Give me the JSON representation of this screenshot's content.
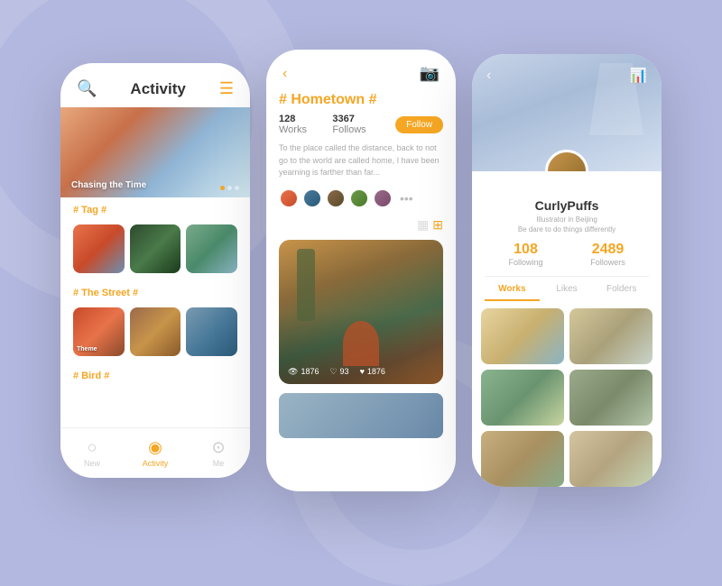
{
  "background_color": "#b3b8e0",
  "phone1": {
    "title": "Activity",
    "hero_label": "Chasing the Time",
    "section_tag": "# Tag #",
    "section_street": "# The Street #",
    "section_bird": "# Bird #",
    "nav": [
      {
        "label": "New",
        "icon": "○",
        "active": false
      },
      {
        "label": "Activity",
        "icon": "◎",
        "active": true
      },
      {
        "label": "Me",
        "icon": "⊙",
        "active": false
      }
    ]
  },
  "phone2": {
    "title_prefix": "#",
    "title": "Hometown",
    "title_suffix": "#",
    "works_count": "128",
    "works_label": "Works",
    "follows_count": "3367",
    "follows_label": "Follows",
    "follow_btn": "Follow",
    "description": "To the place called the distance, back to not go to the world are called home, I have been yearning is farther than far...",
    "img_stats": [
      {
        "icon": "👁",
        "value": "1876"
      },
      {
        "icon": "♡",
        "value": "93"
      },
      {
        "icon": "♥",
        "value": "1876"
      }
    ]
  },
  "phone3": {
    "username": "CurlyPuffs",
    "bio_line1": "Illustrator in Beijing",
    "bio_line2": "Be dare to do things differently",
    "following_count": "108",
    "following_label": "Following",
    "followers_count": "2489",
    "followers_label": "Followers",
    "tabs": [
      "Works",
      "Likes",
      "Folders"
    ]
  }
}
